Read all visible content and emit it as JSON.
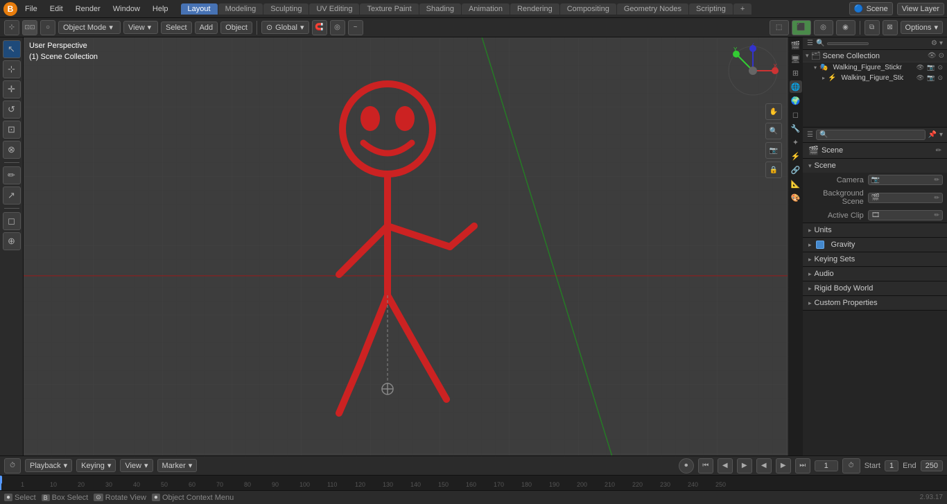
{
  "topMenu": {
    "items": [
      "File",
      "Edit",
      "Render",
      "Window",
      "Help"
    ],
    "workspaceTabs": [
      "Layout",
      "Modeling",
      "Sculpting",
      "UV Editing",
      "Texture Paint",
      "Shading",
      "Animation",
      "Rendering",
      "Compositing",
      "Geometry Nodes",
      "Scripting",
      "+"
    ],
    "activeTab": "Layout",
    "sceneLabel": "Scene",
    "viewLayerLabel": "View Layer"
  },
  "toolbar": {
    "modeSelector": "Object Mode",
    "viewSelector": "View",
    "selectLabel": "Select",
    "addLabel": "Add",
    "objectLabel": "Object",
    "transformSelector": "Global",
    "optionsLabel": "Options"
  },
  "viewport": {
    "perspectiveLabel": "User Perspective",
    "collectionLabel": "(1) Scene Collection"
  },
  "leftTools": {
    "icons": [
      "↖",
      "⊹",
      "↺",
      "⊡",
      "⊗",
      "✏",
      "↗",
      "◻",
      "∿",
      "⊕"
    ]
  },
  "outliner": {
    "title": "Scene Collection",
    "items": [
      {
        "name": "Walking_Figure_Stickman_Re",
        "level": 1,
        "expanded": true,
        "visible": true
      },
      {
        "name": "Walking_Figure_Stickman",
        "level": 2,
        "visible": true
      }
    ]
  },
  "properties": {
    "sceneName": "Scene",
    "sections": {
      "scene": {
        "label": "Scene",
        "camera": {
          "label": "Camera",
          "value": ""
        },
        "backgroundScene": {
          "label": "Background Scene",
          "value": ""
        },
        "activeClip": {
          "label": "Active Clip",
          "value": ""
        }
      },
      "units": {
        "label": "Units"
      },
      "gravity": {
        "label": "Gravity",
        "checked": true
      },
      "keyingSets": {
        "label": "Keying Sets"
      },
      "audio": {
        "label": "Audio"
      },
      "rigidBodyWorld": {
        "label": "Rigid Body World"
      },
      "customProperties": {
        "label": "Custom Properties"
      }
    }
  },
  "timeline": {
    "playbackLabel": "Playback",
    "keyingLabel": "Keying",
    "viewLabel": "View",
    "markerLabel": "Marker",
    "currentFrame": "1",
    "startLabel": "Start",
    "startValue": "1",
    "endLabel": "End",
    "endValue": "250",
    "frameNumbers": [
      "10",
      "20",
      "30",
      "40",
      "50",
      "60",
      "70",
      "80",
      "90",
      "100",
      "110",
      "120",
      "130",
      "140",
      "150",
      "160",
      "170",
      "180",
      "190",
      "200",
      "210",
      "220",
      "230",
      "240",
      "250"
    ]
  },
  "statusBar": {
    "selectLabel": "Select",
    "boxSelectLabel": "Box Select",
    "rotateViewLabel": "Rotate View",
    "objectContextLabel": "Object Context Menu",
    "version": "2.93.17"
  },
  "propsIcons": [
    "🎬",
    "📷",
    "🌐",
    "✨",
    "🔵",
    "🎨",
    "🔧",
    "⚡",
    "📐"
  ]
}
